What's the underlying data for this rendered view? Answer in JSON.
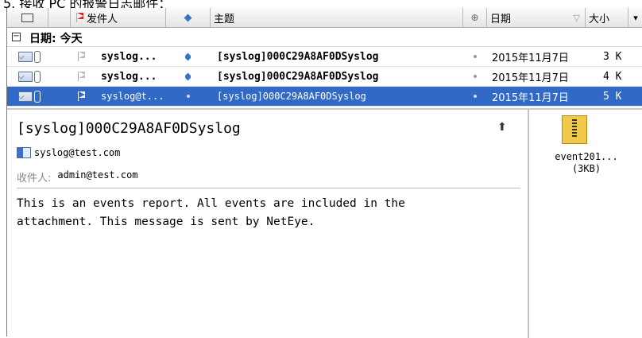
{
  "top_caption": "5.  接收 PC 的报警日志邮件：",
  "columns": {
    "sender": "发件人",
    "subject": "主题",
    "date": "日期",
    "size": "大小",
    "sort_arrow": "▽",
    "more": "▾"
  },
  "group": {
    "toggle": "⊟",
    "label": "日期: 今天"
  },
  "messages": [
    {
      "sender": "syslog...",
      "subject": "[syslog]000C29A8AF0DSyslog",
      "date": "2015年11月7日",
      "size": "3 K",
      "unread": true,
      "selected": false
    },
    {
      "sender": "syslog...",
      "subject": "[syslog]000C29A8AF0DSyslog",
      "date": "2015年11月7日",
      "size": "4 K",
      "unread": true,
      "selected": false
    },
    {
      "sender": "syslog@t...",
      "subject": "[syslog]000C29A8AF0DSyslog",
      "date": "2015年11月7日",
      "size": "5 K",
      "unread": false,
      "selected": true
    }
  ],
  "preview": {
    "subject": "[syslog]000C29A8AF0DSyslog",
    "collapse_glyph": "⌃",
    "from": "syslog@test.com",
    "to_label": "收件人:",
    "to_value": "admin@test.com",
    "body_line1": "This is an events report. All events are included in the",
    "body_line2": "attachment. This message is sent by NetEye."
  },
  "attachment": {
    "name": "event201...",
    "size": "(3KB)",
    "icon": "zip-file-icon"
  },
  "colors": {
    "selection": "#3169c6",
    "importance_diamond": "#3a74c9",
    "flag_red": "#d22222"
  }
}
